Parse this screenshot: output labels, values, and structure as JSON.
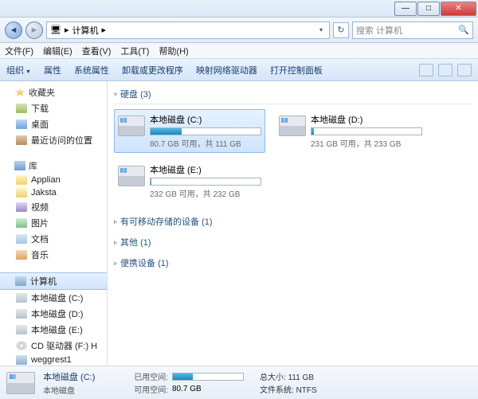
{
  "window": {
    "min": "—",
    "max": "□",
    "close": "✕"
  },
  "nav": {
    "back": "◄",
    "fwd": "►",
    "path_icon": "🖥",
    "path_sep": "▸",
    "path_label": "计算机",
    "path_sep2": "▸",
    "refresh": "↻",
    "search_placeholder": "搜索 计算机",
    "search_icon": "🔍"
  },
  "menu": [
    "文件(F)",
    "编辑(E)",
    "查看(V)",
    "工具(T)",
    "帮助(H)"
  ],
  "toolbar": [
    "组织",
    "属性",
    "系统属性",
    "卸载或更改程序",
    "映射网络驱动器",
    "打开控制面板"
  ],
  "sidebar": {
    "fav_head": "收藏夹",
    "fav": [
      {
        "label": "下载",
        "ic": "ic-dl"
      },
      {
        "label": "桌面",
        "ic": "ic-desk"
      },
      {
        "label": "最近访问的位置",
        "ic": "ic-rec"
      }
    ],
    "lib_head": "库",
    "lib": [
      {
        "label": "Applian",
        "ic": "ic-fold"
      },
      {
        "label": "Jaksta",
        "ic": "ic-fold"
      },
      {
        "label": "视频",
        "ic": "ic-vid"
      },
      {
        "label": "图片",
        "ic": "ic-pic"
      },
      {
        "label": "文档",
        "ic": "ic-doc"
      },
      {
        "label": "音乐",
        "ic": "ic-mus"
      }
    ],
    "comp_head": "计算机",
    "comp": [
      {
        "label": "本地磁盘 (C:)",
        "ic": "ic-drv"
      },
      {
        "label": "本地磁盘 (D:)",
        "ic": "ic-drv"
      },
      {
        "label": "本地磁盘 (E:)",
        "ic": "ic-drv"
      },
      {
        "label": "CD 驱动器 (F:) H",
        "ic": "ic-cd"
      },
      {
        "label": "weggrest1",
        "ic": "ic-net"
      }
    ]
  },
  "content": {
    "hd_head": "硬盘 (3)",
    "drives": [
      {
        "name": "本地磁盘 (C:)",
        "sub": "80.7 GB 可用，共 111 GB",
        "fill": "28%",
        "sel": true
      },
      {
        "name": "本地磁盘 (D:)",
        "sub": "231 GB 可用，共 233 GB",
        "fill": "2%",
        "sel": false
      },
      {
        "name": "本地磁盘 (E:)",
        "sub": "232 GB 可用，共 232 GB",
        "fill": "1%",
        "sel": false
      }
    ],
    "groups": [
      "有可移动存储的设备 (1)",
      "其他 (1)",
      "便携设备 (1)"
    ]
  },
  "details": {
    "name": "本地磁盘 (C:)",
    "type": "本地磁盘",
    "used_label": "已用空间:",
    "free_label": "可用空间:",
    "free_val": "80.7 GB",
    "size_label": "总大小:",
    "size_val": "111 GB",
    "fs_label": "文件系统:",
    "fs_val": "NTFS",
    "fill": "28%"
  }
}
